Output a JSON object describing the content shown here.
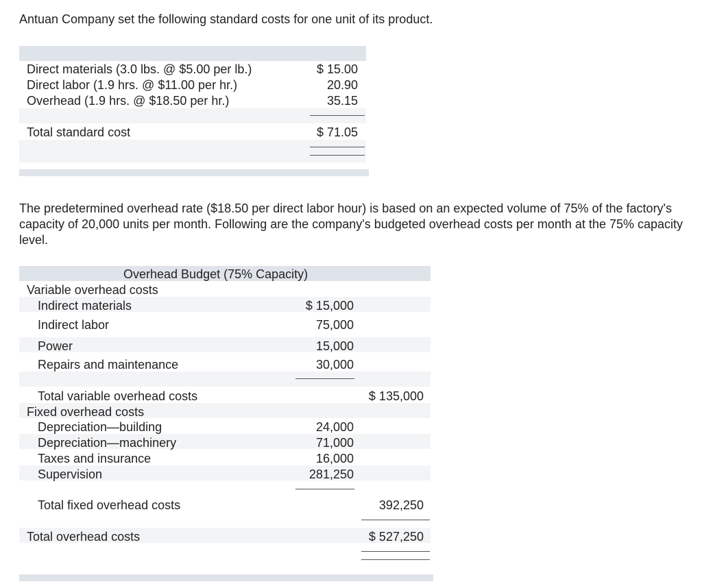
{
  "intro": "Antuan Company set the following standard costs for one unit of its product.",
  "standard_costs": {
    "rows": [
      {
        "label": "Direct materials (3.0 lbs. @ $5.00 per lb.)",
        "amount": "$ 15.00"
      },
      {
        "label": "Direct labor (1.9 hrs. @ $11.00 per hr.)",
        "amount": "20.90"
      },
      {
        "label": "Overhead (1.9 hrs. @ $18.50 per hr.)",
        "amount": "35.15"
      }
    ],
    "total_label": "Total standard cost",
    "total_amount": "$ 71.05"
  },
  "paragraph": "The predetermined overhead rate ($18.50 per direct labor hour) is based on an expected volume of 75% of the factory's capacity of 20,000 units per month. Following are the company's budgeted overhead costs per month at the 75% capacity level.",
  "overhead_budget": {
    "title": "Overhead Budget (75% Capacity)",
    "variable_header": "Variable overhead costs",
    "variable_items": [
      {
        "label": "Indirect materials",
        "amount": "$ 15,000"
      },
      {
        "label": "Indirect labor",
        "amount": "75,000"
      },
      {
        "label": "Power",
        "amount": "15,000"
      },
      {
        "label": "Repairs and maintenance",
        "amount": "30,000"
      }
    ],
    "total_variable_label": "Total variable overhead costs",
    "total_variable_amount": "$ 135,000",
    "fixed_header": "Fixed overhead costs",
    "fixed_items": [
      {
        "label": "Depreciation—building",
        "amount": "24,000"
      },
      {
        "label": "Depreciation—machinery",
        "amount": "71,000"
      },
      {
        "label": "Taxes and insurance",
        "amount": "16,000"
      },
      {
        "label": "Supervision",
        "amount": "281,250"
      }
    ],
    "total_fixed_label": "Total fixed overhead costs",
    "total_fixed_amount": "392,250",
    "total_overhead_label": "Total overhead costs",
    "total_overhead_amount": "$ 527,250"
  }
}
